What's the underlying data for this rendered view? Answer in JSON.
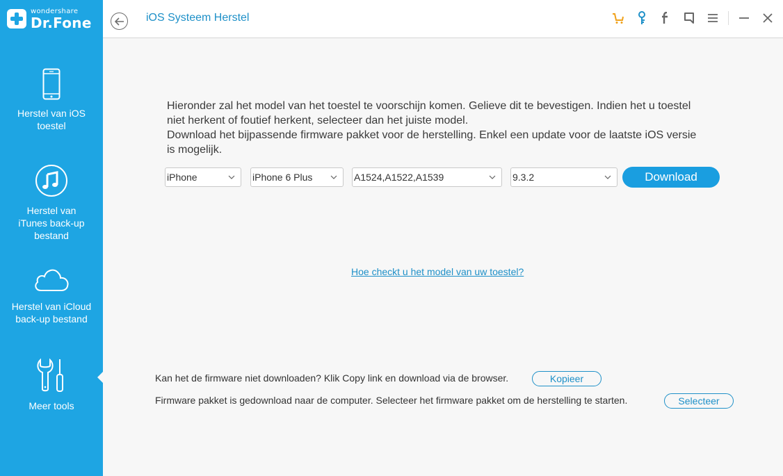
{
  "app": {
    "brand_small": "wondershare",
    "brand_big": "Dr.Fone",
    "accent_color": "#1ea5e3"
  },
  "sidebar": {
    "items": [
      {
        "label": "Herstel van iOS toestel",
        "icon": "phone-icon"
      },
      {
        "label": "Herstel van iTunes back-up bestand",
        "icon": "music-note-icon"
      },
      {
        "label": "Herstel van iCloud back-up bestand",
        "icon": "cloud-icon"
      },
      {
        "label": "Meer tools",
        "icon": "tools-icon",
        "active": true
      }
    ]
  },
  "header": {
    "title": "iOS Systeem Herstel",
    "icons": [
      "cart-icon",
      "key-icon",
      "facebook-icon",
      "feedback-icon",
      "menu-icon",
      "minimize-icon",
      "close-icon"
    ]
  },
  "main": {
    "intro_line1": "Hieronder zal het model van het toestel te voorschijn komen. Gelieve dit te bevestigen. Indien het u toestel niet herkent of foutief herkent, selecteer dan het juiste model.",
    "intro_line2": "Download het bijpassende firmware pakket voor de herstelling. Enkel een update voor de laatste iOS versie is mogelijk.",
    "selects": {
      "brand": "iPhone",
      "model": "iPhone 6 Plus",
      "model_codes": "A1524,A1522,A1539",
      "version": "9.3.2"
    },
    "download_label": "Download",
    "help_link": "Hoe checkt u het model van uw toestel?",
    "copy_text": "Kan het de firmware niet downloaden? Klik Copy link en download via de browser.",
    "copy_button": "Kopieer",
    "select_text": "Firmware pakket is gedownload naar de computer. Selecteer het firmware pakket om de herstelling te starten.",
    "select_button": "Selecteer"
  }
}
